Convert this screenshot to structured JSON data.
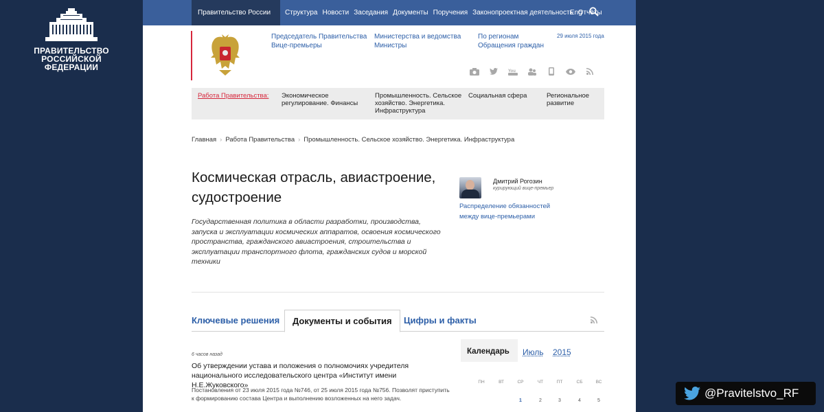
{
  "logo": {
    "line1": "ПРАВИТЕЛЬСТВО",
    "line2": "РОССИЙСКОЙ",
    "line3": "ФЕДЕРАЦИИ"
  },
  "topnav": {
    "brand": "Правительство России",
    "items": [
      "Структура",
      "Новости",
      "Заседания",
      "Документы",
      "Поручения",
      "Законопроектная деятельность",
      "Отчёты"
    ],
    "lang": "Eng"
  },
  "header": {
    "col1": [
      "Председатель Правительства",
      "Вице-премьеры"
    ],
    "col2": [
      "Министерства и ведомства",
      "Министры"
    ],
    "col3": [
      "По регионам",
      "Обращения граждан"
    ],
    "date": "29 июля 2015 года",
    "icons": [
      "camera-icon",
      "twitter-icon",
      "youtube-icon",
      "people-icon",
      "mobile-icon",
      "eye-icon",
      "rss-icon"
    ]
  },
  "worknav": {
    "label": "Работа Правительства:",
    "items": [
      [
        "Экономическое",
        "регулирование. Финансы"
      ],
      [
        "Промышленность. Сельское",
        "хозяйство. Энергетика.",
        "Инфраструктура"
      ],
      [
        "Социальная сфера"
      ],
      [
        "Региональное",
        "развитие"
      ]
    ]
  },
  "breadcrumb": [
    "Главная",
    "Работа Правительства",
    "Промышленность. Сельское хозяйство. Энергетика. Инфраструктура"
  ],
  "article": {
    "title_line1": "Космическая отрасль, авиастроение,",
    "title_line2": "судостроение",
    "lead": "Государственная политика в области разработки, производства, запуска и эксплуатации космических аппаратов, освоения космического пространства, гражданского авиастроения, строительства и эксплуатации транспортного флота, гражданских судов и морской техники"
  },
  "person": {
    "name": "Дмитрий Рогозин",
    "role": "курирующий вице-премьер",
    "link": "Распределение обязанностей между вице-премьерами"
  },
  "tabs": [
    "Ключевые решения",
    "Документы и события",
    "Цифры и факты"
  ],
  "news": {
    "time": "6 часов назад",
    "title": "Об утверждении устава и положения о полномочиях учредителя национального исследовательского центра «Институт имени Н.Е.Жуковского»",
    "body": "Постановления от 23 июля 2015 года №746, от 25 июля 2015 года №756. Позволят приступить к формированию состава Центра и выполнению возложенных на него задач."
  },
  "calendar": {
    "title": "Календарь",
    "month": "Июль",
    "year": "2015",
    "weekdays": [
      "ПН",
      "ВТ",
      "СР",
      "ЧТ",
      "ПТ",
      "СБ",
      "ВС"
    ],
    "days": [
      "1",
      "2",
      "3",
      "4",
      "5"
    ]
  },
  "twitter": {
    "handle": "@Pravitelstvo_RF"
  },
  "colors": {
    "nav": "#3a5f9b",
    "brand": "#253a5d",
    "accent_red": "#d6263b",
    "link": "#2d5fa8",
    "background": "#1a2d4c"
  }
}
